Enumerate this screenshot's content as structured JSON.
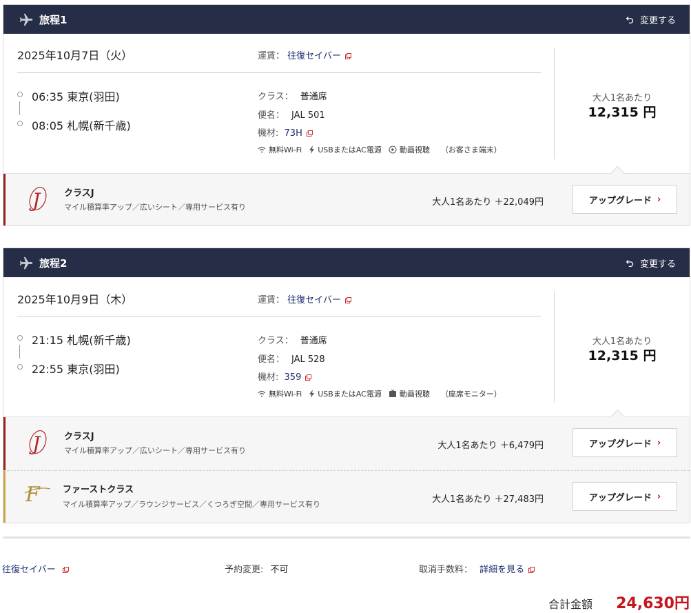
{
  "itineraries": [
    {
      "title": "旅程1",
      "change_label": "変更する",
      "date": "2025年10月7日（火）",
      "fare_label": "運賃：",
      "fare_value": "往復セイバー",
      "departure": {
        "time": "06:35",
        "airport": "東京(羽田)"
      },
      "arrival": {
        "time": "08:05",
        "airport": "札幌(新千歳)"
      },
      "class_label": "クラス：",
      "class_value": "普通席",
      "flight_label": "便名：",
      "flight_value": "JAL 501",
      "aircraft_label": "機材:",
      "aircraft_value": "73H",
      "amenities": [
        "無料Wi-Fi",
        "USBまたはAC電源",
        "動画視聴",
        "（お客さま端末）"
      ],
      "per_person_label": "大人1名あたり",
      "price": "12,315 円",
      "upgrades": [
        {
          "name": "クラスJ",
          "desc": "マイル積算率アップ／広いシート／専用サービス有り",
          "price": "大人1名あたり ＋22,049円",
          "button": "アップグレード",
          "color": "#9b1b1f"
        }
      ]
    },
    {
      "title": "旅程2",
      "change_label": "変更する",
      "date": "2025年10月9日（木）",
      "fare_label": "運賃：",
      "fare_value": "往復セイバー",
      "departure": {
        "time": "21:15",
        "airport": "札幌(新千歳)"
      },
      "arrival": {
        "time": "22:55",
        "airport": "東京(羽田)"
      },
      "class_label": "クラス：",
      "class_value": "普通席",
      "flight_label": "便名：",
      "flight_value": "JAL 528",
      "aircraft_label": "機材:",
      "aircraft_value": "359",
      "amenities": [
        "無料Wi-Fi",
        "USBまたはAC電源",
        "動画視聴",
        "（座席モニター）"
      ],
      "per_person_label": "大人1名あたり",
      "price": "12,315 円",
      "upgrades": [
        {
          "name": "クラスJ",
          "desc": "マイル積算率アップ／広いシート／専用サービス有り",
          "price": "大人1名あたり ＋6,479円",
          "button": "アップグレード",
          "color": "#9b1b1f"
        },
        {
          "name": "ファーストクラス",
          "desc": "マイル積算率アップ／ラウンジサービス／くつろぎ空間／専用サービス有り",
          "price": "大人1名あたり ＋27,483円",
          "button": "アップグレード",
          "color": "#c9a646"
        }
      ]
    }
  ],
  "footer": {
    "fare_link": "往復セイバー",
    "change_label": "予約変更:",
    "change_value": "不可",
    "cancel_label": "取消手数料：",
    "cancel_link": "詳細を見る",
    "total_label": "合計金額",
    "total_value": "24,630円"
  },
  "colors": {
    "header": "#262e47",
    "accent": "#c4161c",
    "link": "#1a2d6b",
    "gold": "#c9a646"
  }
}
